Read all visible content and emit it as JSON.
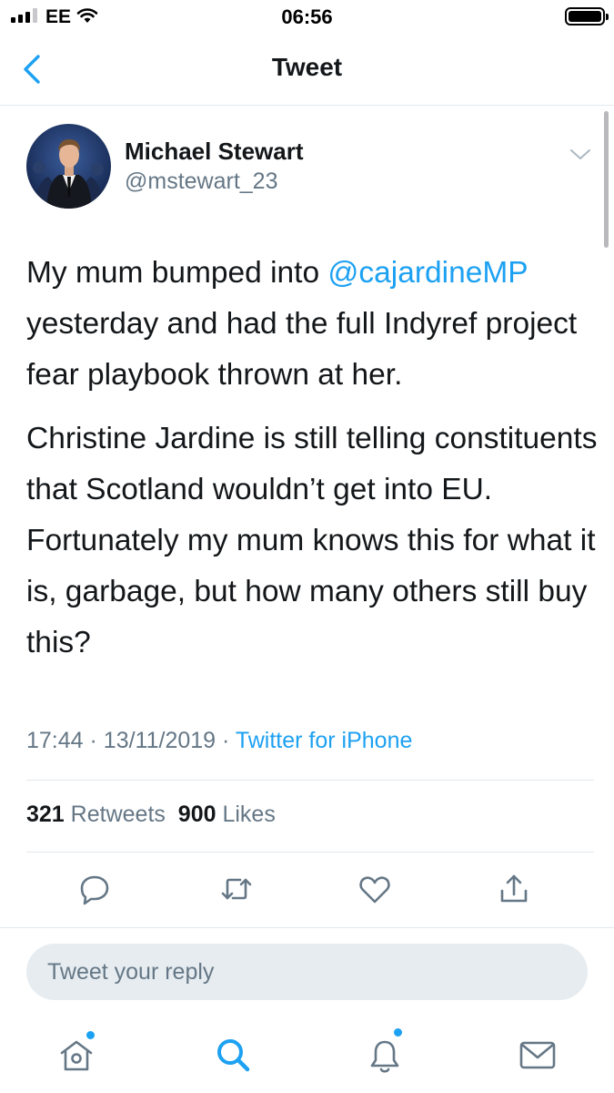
{
  "status_bar": {
    "carrier": "EE",
    "time": "06:56",
    "signal_bars": 3,
    "battery_level": 1.0
  },
  "nav": {
    "title": "Tweet",
    "back_icon": "chevron-left-icon"
  },
  "tweet": {
    "author_name": "Michael Stewart",
    "author_handle": "@mstewart_23",
    "para1_prefix": "My mum bumped into ",
    "mention": "@cajardineMP",
    "para1_suffix": " yesterday and had the full Indyref project fear playbook thrown at her.",
    "para2": "Christine Jardine is still telling constituents that Scotland wouldn’t get into EU. Fortunately my mum knows this for what it is, garbage, but how many others still buy this?",
    "time": "17:44",
    "date": "13/11/2019",
    "separator": "·",
    "source": "Twitter for iPhone",
    "retweets_count": "321",
    "retweets_label": "Retweets",
    "likes_count": "900",
    "likes_label": "Likes"
  },
  "actions": [
    "reply-icon",
    "retweet-icon",
    "like-icon",
    "share-icon"
  ],
  "reply_box": {
    "placeholder": "Tweet your reply"
  },
  "tab_bar": [
    "home-icon",
    "search-icon",
    "notifications-icon",
    "messages-icon"
  ],
  "colors": {
    "accent": "#1da1f2",
    "secondary_text": "#657786",
    "divider": "#e1e8ed"
  }
}
